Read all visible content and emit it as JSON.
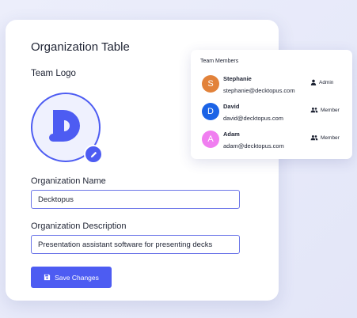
{
  "form": {
    "title": "Organization Table",
    "logo_label": "Team Logo",
    "name_label": "Organization Name",
    "name_value": "Decktopus",
    "description_label": "Organization Description",
    "description_value": "Presentation assistant software for presenting decks",
    "save_label": "Save Changes"
  },
  "team": {
    "title": "Team Members",
    "members": [
      {
        "initial": "S",
        "name": "Stephanie",
        "email": "stephanie@decktopus.com",
        "role": "Admin",
        "role_icon": "person-icon",
        "color": "#e2823a"
      },
      {
        "initial": "D",
        "name": "David",
        "email": "david@decktopus.com",
        "role": "Member",
        "role_icon": "group-icon",
        "color": "#1b63e6"
      },
      {
        "initial": "A",
        "name": "Adam",
        "email": "adam@decktopus.com",
        "role": "Member",
        "role_icon": "group-icon",
        "color": "#f07ef0"
      }
    ]
  },
  "colors": {
    "accent": "#4d5cf2",
    "logo_bg": "#eff1fe"
  }
}
